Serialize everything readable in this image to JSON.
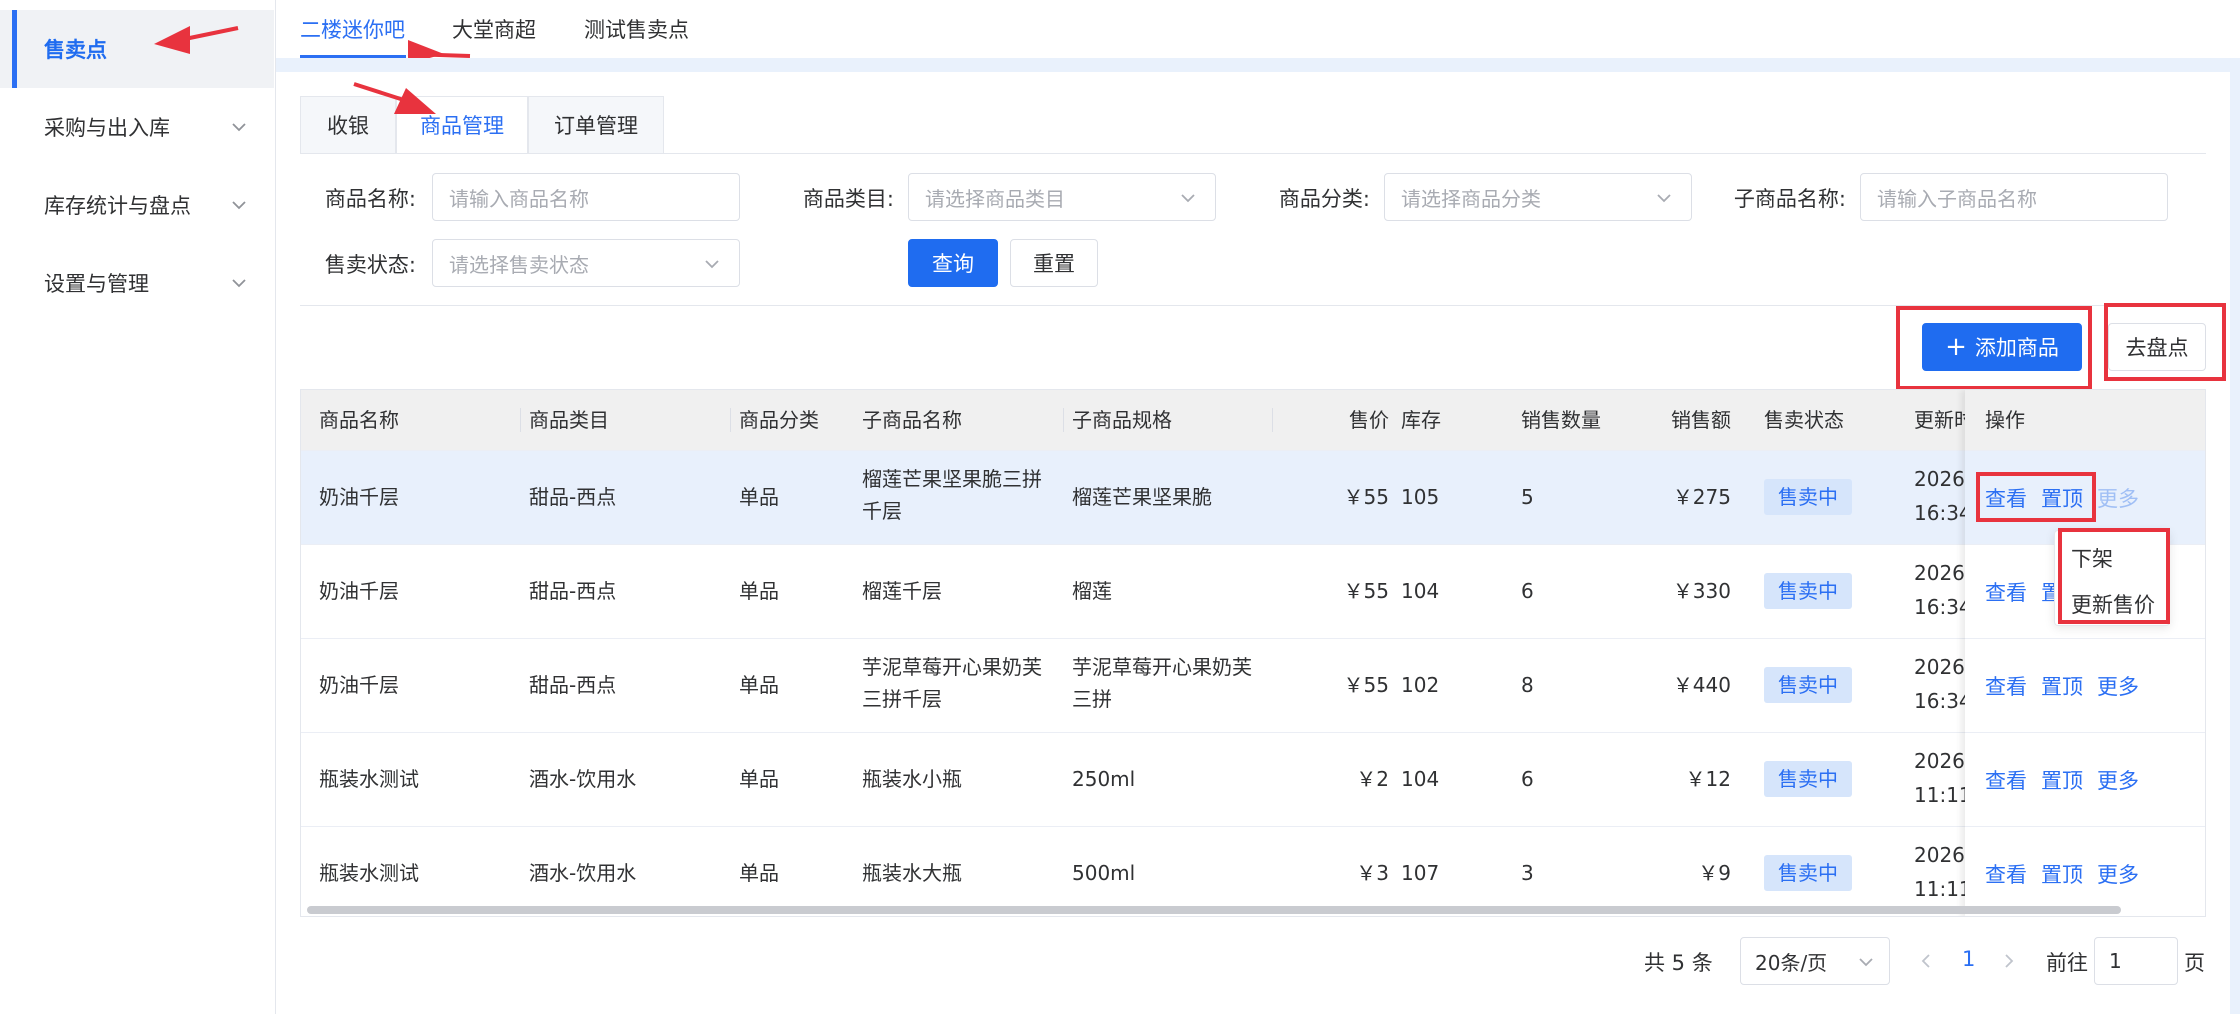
{
  "sidebar": {
    "items": [
      {
        "label": "售卖点"
      },
      {
        "label": "采购与出入库"
      },
      {
        "label": "库存统计与盘点"
      },
      {
        "label": "设置与管理"
      }
    ]
  },
  "top_tabs": [
    "二楼迷你吧",
    "大堂商超",
    "测试售卖点"
  ],
  "card_tabs": [
    "收银",
    "商品管理",
    "订单管理"
  ],
  "filters": {
    "product_name": {
      "label": "商品名称:",
      "placeholder": "请输入商品名称"
    },
    "product_category": {
      "label": "商品类目:",
      "placeholder": "请选择商品类目"
    },
    "product_class": {
      "label": "商品分类:",
      "placeholder": "请选择商品分类"
    },
    "sub_product_name": {
      "label": "子商品名称:",
      "placeholder": "请输入子商品名称"
    },
    "sale_status": {
      "label": "售卖状态:",
      "placeholder": "请选择售卖状态"
    },
    "query_label": "查询",
    "reset_label": "重置"
  },
  "actions": {
    "add_label": "添加商品",
    "stocktake_label": "去盘点"
  },
  "table": {
    "headers": [
      "商品名称",
      "商品类目",
      "商品分类",
      "子商品名称",
      "子商品规格",
      "售价",
      "库存",
      "销售数量",
      "销售额",
      "售卖状态",
      "更新时"
    ],
    "op_header": "操作",
    "rows": [
      {
        "name": "奶油千层",
        "category": "甜品-西点",
        "class": "单品",
        "sub_name": "榴莲芒果坚果脆三拼千层",
        "spec": "榴莲芒果坚果脆",
        "price": "￥55",
        "stock": "105",
        "sold": "5",
        "revenue": "￥275",
        "status": "售卖中",
        "date": "2026-",
        "time": "16:34"
      },
      {
        "name": "奶油千层",
        "category": "甜品-西点",
        "class": "单品",
        "sub_name": "榴莲千层",
        "spec": "榴莲",
        "price": "￥55",
        "stock": "104",
        "sold": "6",
        "revenue": "￥330",
        "status": "售卖中",
        "date": "2026-",
        "time": "16:34"
      },
      {
        "name": "奶油千层",
        "category": "甜品-西点",
        "class": "单品",
        "sub_name": "芋泥草莓开心果奶芙三拼千层",
        "spec": "芋泥草莓开心果奶芙三拼",
        "price": "￥55",
        "stock": "102",
        "sold": "8",
        "revenue": "￥440",
        "status": "售卖中",
        "date": "2026-",
        "time": "16:34"
      },
      {
        "name": "瓶装水测试",
        "category": "酒水-饮用水",
        "class": "单品",
        "sub_name": "瓶装水小瓶",
        "spec": "250ml",
        "price": "￥2",
        "stock": "104",
        "sold": "6",
        "revenue": "￥12",
        "status": "售卖中",
        "date": "2026-",
        "time": "11:11"
      },
      {
        "name": "瓶装水测试",
        "category": "酒水-饮用水",
        "class": "单品",
        "sub_name": "瓶装水大瓶",
        "spec": "500ml",
        "price": "￥3",
        "stock": "107",
        "sold": "3",
        "revenue": "￥9",
        "status": "售卖中",
        "date": "2026-",
        "time": "11:11"
      }
    ],
    "ops": {
      "view": "查看",
      "top": "置顶",
      "more": "更多"
    }
  },
  "dropdown": [
    "下架",
    "更新售价"
  ],
  "pagination": {
    "total": "共 5 条",
    "page_size": "20条/页",
    "current": "1",
    "goto_prefix": "前往",
    "goto_value": "1",
    "goto_suffix": "页"
  },
  "colors": {
    "primary": "#1f6cf0",
    "annotation": "#e8333e",
    "row_highlight": "#e8f0fc"
  }
}
